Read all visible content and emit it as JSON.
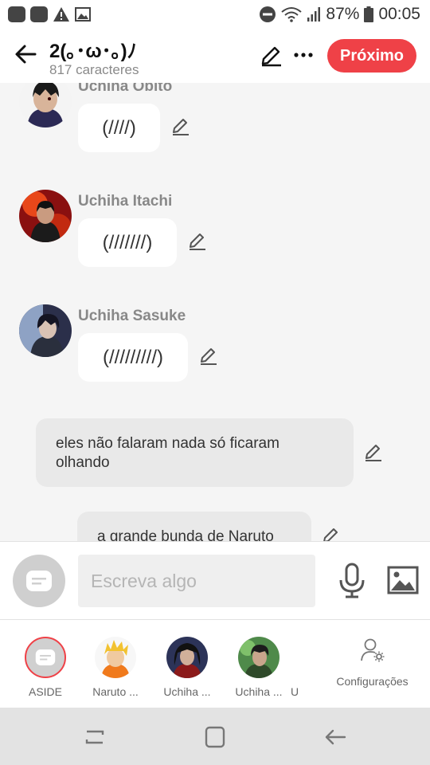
{
  "status_bar": {
    "battery": "87%",
    "time": "00:05"
  },
  "header": {
    "title": "2(｡･ω･｡)ﾉ",
    "subtitle": "817 caracteres",
    "next_label": "Próximo"
  },
  "chat": {
    "messages": [
      {
        "name": "Uchiha Obito",
        "text": "(////)"
      },
      {
        "name": "Uchiha Itachi",
        "text": "(///////)"
      },
      {
        "name": "Uchiha Sasuke",
        "text": "(/////////)"
      }
    ],
    "narrations": [
      {
        "text": "eles não falaram nada só ficaram olhando"
      },
      {
        "text": "a grande bunda de Naruto"
      }
    ]
  },
  "composer": {
    "placeholder": "Escreva algo"
  },
  "characters": [
    {
      "label": "ASIDE"
    },
    {
      "label": "Naruto ..."
    },
    {
      "label": "Uchiha ..."
    },
    {
      "label": "Uchiha ..."
    },
    {
      "label": "U"
    }
  ],
  "settings_label": "Configurações",
  "colors": {
    "accent": "#ef4147",
    "bubble": "#ffffff",
    "narration": "#e9e9e9"
  }
}
